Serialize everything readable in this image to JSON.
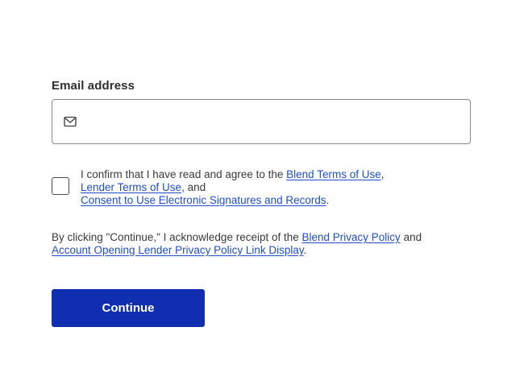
{
  "email": {
    "label": "Email address",
    "value": "",
    "placeholder": "",
    "icon": "mail-icon"
  },
  "consent": {
    "checked": false,
    "prefix": "I confirm that I have read and agree to the ",
    "link1": "Blend Terms of Use",
    "sep1": ", ",
    "link2": "Lender Terms of Use",
    "sep2": ", and ",
    "link3": "Consent to Use Electronic Signatures and Records",
    "suffix": "."
  },
  "acknowledgement": {
    "prefix": "By clicking \"Continue,\" I acknowledge receipt of the ",
    "link1": "Blend Privacy Policy",
    "sep1": " and ",
    "link2": "Account Opening Lender Privacy Policy Link Display",
    "suffix": "."
  },
  "continue_button": {
    "label": "Continue"
  },
  "colors": {
    "primary": "#0f2fb0",
    "link": "#1e4fc8",
    "border": "#8a8a8a"
  }
}
